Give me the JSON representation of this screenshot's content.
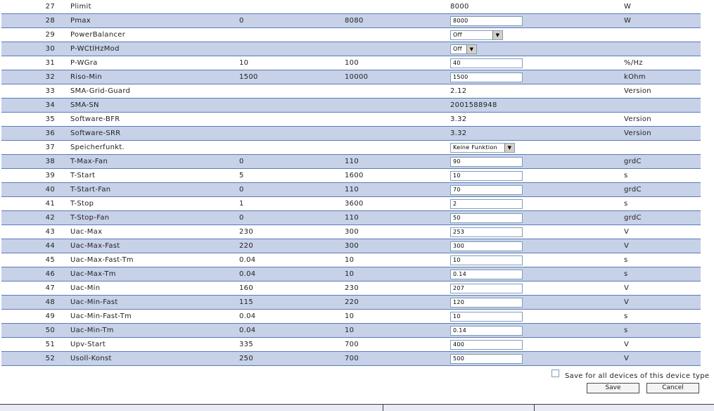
{
  "rows": [
    {
      "num": "27",
      "name": "Plimit",
      "min": "",
      "max": "",
      "value": "8000",
      "kind": "text",
      "unit": "W"
    },
    {
      "num": "28",
      "name": "Pmax",
      "min": "0",
      "max": "8080",
      "value": "8000",
      "kind": "input",
      "unit": "W"
    },
    {
      "num": "29",
      "name": "PowerBalancer",
      "min": "",
      "max": "",
      "value": "Off",
      "kind": "select",
      "unit": ""
    },
    {
      "num": "30",
      "name": "P-WCtlHzMod",
      "min": "",
      "max": "",
      "value": "Off",
      "kind": "select",
      "unit": ""
    },
    {
      "num": "31",
      "name": "P-WGra",
      "min": "10",
      "max": "100",
      "value": "40",
      "kind": "input",
      "unit": "%/Hz"
    },
    {
      "num": "32",
      "name": "Riso-Min",
      "min": "1500",
      "max": "10000",
      "value": "1500",
      "kind": "input",
      "unit": "kOhm"
    },
    {
      "num": "33",
      "name": "SMA-Grid-Guard",
      "min": "",
      "max": "",
      "value": "2.12",
      "kind": "text",
      "unit": "Version"
    },
    {
      "num": "34",
      "name": "SMA-SN",
      "min": "",
      "max": "",
      "value": "2001588948",
      "kind": "text",
      "unit": ""
    },
    {
      "num": "35",
      "name": "Software-BFR",
      "min": "",
      "max": "",
      "value": "3.32",
      "kind": "text",
      "unit": "Version"
    },
    {
      "num": "36",
      "name": "Software-SRR",
      "min": "",
      "max": "",
      "value": "3.32",
      "kind": "text",
      "unit": "Version"
    },
    {
      "num": "37",
      "name": "Speicherfunkt.",
      "min": "",
      "max": "",
      "value": "Keine Funktion",
      "kind": "select",
      "unit": ""
    },
    {
      "num": "38",
      "name": "T-Max-Fan",
      "min": "0",
      "max": "110",
      "value": "90",
      "kind": "input",
      "unit": "grdC"
    },
    {
      "num": "39",
      "name": "T-Start",
      "min": "5",
      "max": "1600",
      "value": "10",
      "kind": "input",
      "unit": "s"
    },
    {
      "num": "40",
      "name": "T-Start-Fan",
      "min": "0",
      "max": "110",
      "value": "70",
      "kind": "input",
      "unit": "grdC"
    },
    {
      "num": "41",
      "name": "T-Stop",
      "min": "1",
      "max": "3600",
      "value": "2",
      "kind": "input",
      "unit": "s"
    },
    {
      "num": "42",
      "name": "T-Stop-Fan",
      "min": "0",
      "max": "110",
      "value": "50",
      "kind": "input",
      "unit": "grdC"
    },
    {
      "num": "43",
      "name": "Uac-Max",
      "min": "230",
      "max": "300",
      "value": "253",
      "kind": "input",
      "unit": "V"
    },
    {
      "num": "44",
      "name": "Uac-Max-Fast",
      "min": "220",
      "max": "300",
      "value": "300",
      "kind": "input",
      "unit": "V"
    },
    {
      "num": "45",
      "name": "Uac-Max-Fast-Tm",
      "min": "0.04",
      "max": "10",
      "value": "10",
      "kind": "input",
      "unit": "s"
    },
    {
      "num": "46",
      "name": "Uac-Max-Tm",
      "min": "0.04",
      "max": "10",
      "value": "0.14",
      "kind": "input",
      "unit": "s"
    },
    {
      "num": "47",
      "name": "Uac-Min",
      "min": "160",
      "max": "230",
      "value": "207",
      "kind": "input",
      "unit": "V"
    },
    {
      "num": "48",
      "name": "Uac-Min-Fast",
      "min": "115",
      "max": "220",
      "value": "120",
      "kind": "input",
      "unit": "V"
    },
    {
      "num": "49",
      "name": "Uac-Min-Fast-Tm",
      "min": "0.04",
      "max": "10",
      "value": "10",
      "kind": "input",
      "unit": "s"
    },
    {
      "num": "50",
      "name": "Uac-Min-Tm",
      "min": "0.04",
      "max": "10",
      "value": "0.14",
      "kind": "input",
      "unit": "s"
    },
    {
      "num": "51",
      "name": "Upv-Start",
      "min": "335",
      "max": "700",
      "value": "400",
      "kind": "input",
      "unit": "V"
    },
    {
      "num": "52",
      "name": "Usoll-Konst",
      "min": "250",
      "max": "700",
      "value": "500",
      "kind": "input",
      "unit": "V"
    }
  ],
  "save_all_label": "Save for all devices of this device type",
  "save_button": "Save",
  "cancel_button": "Cancel",
  "colors": {
    "row_alt": "#c7d2e8",
    "row_border": "#5d79b8"
  }
}
